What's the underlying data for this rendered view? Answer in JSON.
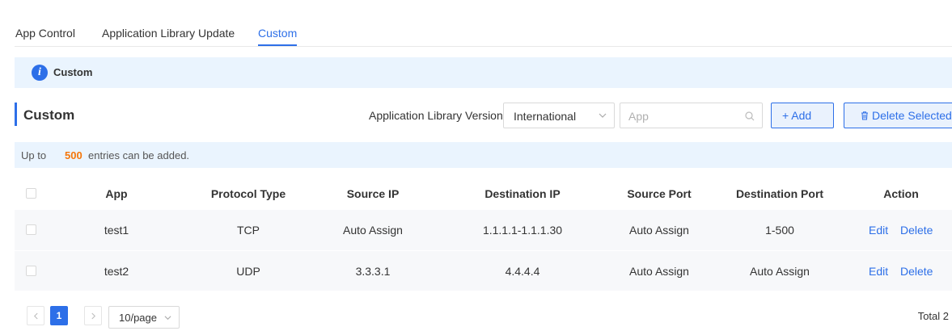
{
  "tabs": [
    {
      "label": "App Control"
    },
    {
      "label": "Application Library Update"
    },
    {
      "label": "Custom"
    }
  ],
  "banner": {
    "title": "Custom",
    "icon": "info-icon"
  },
  "section": {
    "title": "Custom"
  },
  "toolbar": {
    "version_label": "Application Library Version:",
    "version_value": "International",
    "search_placeholder": "App",
    "add_label": "+ Add",
    "delete_label": "Delete Selected"
  },
  "tip": {
    "prefix": "Up to",
    "count": "500",
    "suffix": "entries can be added."
  },
  "table": {
    "columns": [
      "App",
      "Protocol Type",
      "Source IP",
      "Destination IP",
      "Source Port",
      "Destination Port",
      "Action"
    ],
    "rows": [
      {
        "app": "test1",
        "protocol": "TCP",
        "source_ip": "Auto Assign",
        "dest_ip": "1.1.1.1-1.1.1.30",
        "source_port": "Auto Assign",
        "dest_port": "1-500"
      },
      {
        "app": "test2",
        "protocol": "UDP",
        "source_ip": "3.3.3.1",
        "dest_ip": "4.4.4.4",
        "source_port": "Auto Assign",
        "dest_port": "Auto Assign"
      }
    ],
    "actions": {
      "edit": "Edit",
      "delete": "Delete"
    }
  },
  "pagination": {
    "current_page": "1",
    "page_size": "10/page",
    "total": "Total 2"
  },
  "colors": {
    "accent": "#2d6fe8",
    "highlight": "#f5760a",
    "banner_bg": "#eaf4fe"
  }
}
